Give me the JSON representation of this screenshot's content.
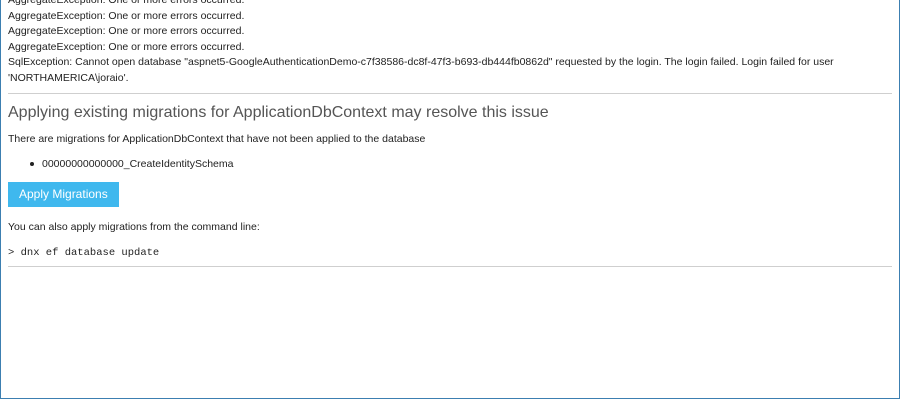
{
  "errors": {
    "lines": [
      "AggregateException: One or more errors occurred.",
      "AggregateException: One or more errors occurred.",
      "AggregateException: One or more errors occurred.",
      "AggregateException: One or more errors occurred.",
      "SqlException: Cannot open database \"aspnet5-GoogleAuthenticationDemo-c7f38586-dc8f-47f3-b693-db444fb0862d\" requested by the login. The login failed. Login failed for user 'NORTHAMERICA\\joraio'."
    ]
  },
  "migrations": {
    "title": "Applying existing migrations for ApplicationDbContext may resolve this issue",
    "description": "There are migrations for ApplicationDbContext that have not been applied to the database",
    "items": [
      "00000000000000_CreateIdentitySchema"
    ],
    "apply_button_label": "Apply Migrations",
    "command_description": "You can also apply migrations from the command line:",
    "command": "> dnx ef database update"
  },
  "colors": {
    "button_bg": "#3fb8ee",
    "frame_border": "#3c7fb1",
    "divider": "#cfcfcf"
  }
}
